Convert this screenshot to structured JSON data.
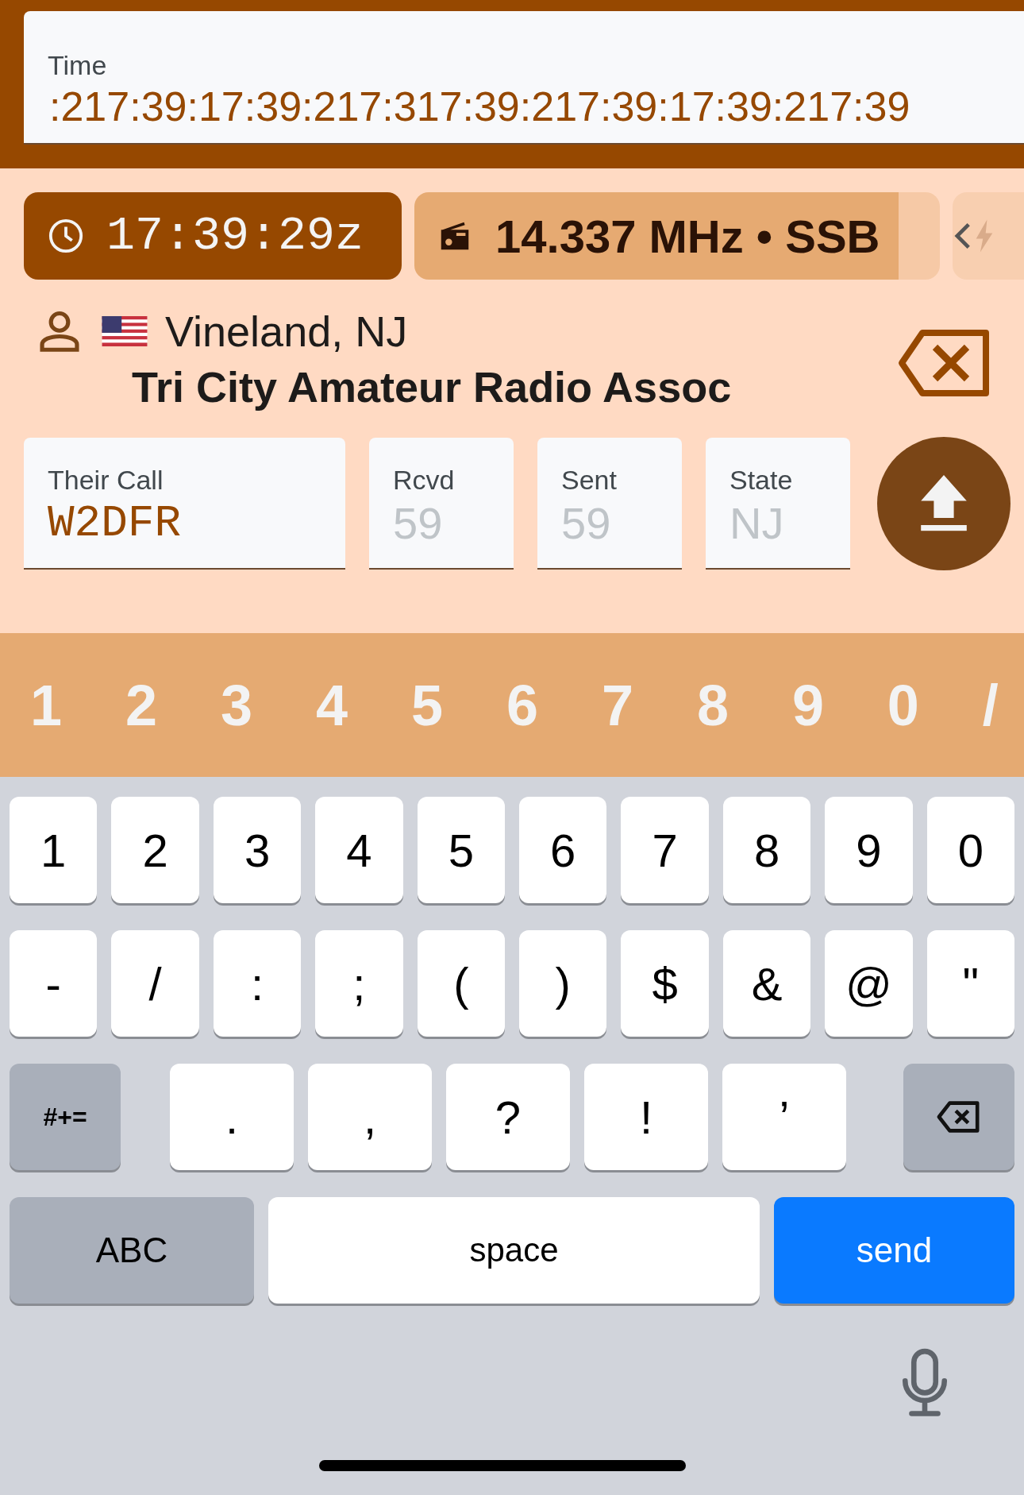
{
  "time_field": {
    "label": "Time",
    "value": ":217:39:17:39:217:317:39:217:39:17:39:217:39"
  },
  "chips": {
    "clock": "17:39:29z",
    "frequency": "14.337 MHz • SSB"
  },
  "station": {
    "location": "Vineland, NJ",
    "club": "Tri City Amateur Radio Assoc"
  },
  "fields": [
    {
      "label": "Their Call",
      "value": "W2DFR",
      "kind": "call"
    },
    {
      "label": "Rcvd",
      "placeholder": "59",
      "kind": "short"
    },
    {
      "label": "Sent",
      "placeholder": "59",
      "kind": "short"
    },
    {
      "label": "State",
      "placeholder": "NJ",
      "kind": "short"
    }
  ],
  "quick_keys": [
    "1",
    "2",
    "3",
    "4",
    "5",
    "6",
    "7",
    "8",
    "9",
    "0",
    "/"
  ],
  "keyboard": [
    [
      {
        "label": "1",
        "kind": "char"
      },
      {
        "label": "2",
        "kind": "char"
      },
      {
        "label": "3",
        "kind": "char"
      },
      {
        "label": "4",
        "kind": "char"
      },
      {
        "label": "5",
        "kind": "char"
      },
      {
        "label": "6",
        "kind": "char"
      },
      {
        "label": "7",
        "kind": "char"
      },
      {
        "label": "8",
        "kind": "char"
      },
      {
        "label": "9",
        "kind": "char"
      },
      {
        "label": "0",
        "kind": "char"
      }
    ],
    [
      {
        "label": "-",
        "kind": "char"
      },
      {
        "label": "/",
        "kind": "char"
      },
      {
        "label": ":",
        "kind": "char"
      },
      {
        "label": ";",
        "kind": "char"
      },
      {
        "label": "(",
        "kind": "char"
      },
      {
        "label": ")",
        "kind": "char"
      },
      {
        "label": "$",
        "kind": "char"
      },
      {
        "label": "&",
        "kind": "char"
      },
      {
        "label": "@",
        "kind": "char"
      },
      {
        "label": "\"",
        "kind": "char"
      }
    ],
    [
      {
        "label": "#+=",
        "kind": "function"
      },
      {
        "label": ".",
        "kind": "char"
      },
      {
        "label": ",",
        "kind": "char"
      },
      {
        "label": "?",
        "kind": "char"
      },
      {
        "label": "!",
        "kind": "char"
      },
      {
        "label": "’",
        "kind": "char"
      },
      {
        "kind": "backspace"
      }
    ],
    [
      {
        "label": "ABC",
        "kind": "mode"
      },
      {
        "label": "space",
        "kind": "space"
      },
      {
        "label": "send",
        "kind": "action"
      }
    ]
  ]
}
